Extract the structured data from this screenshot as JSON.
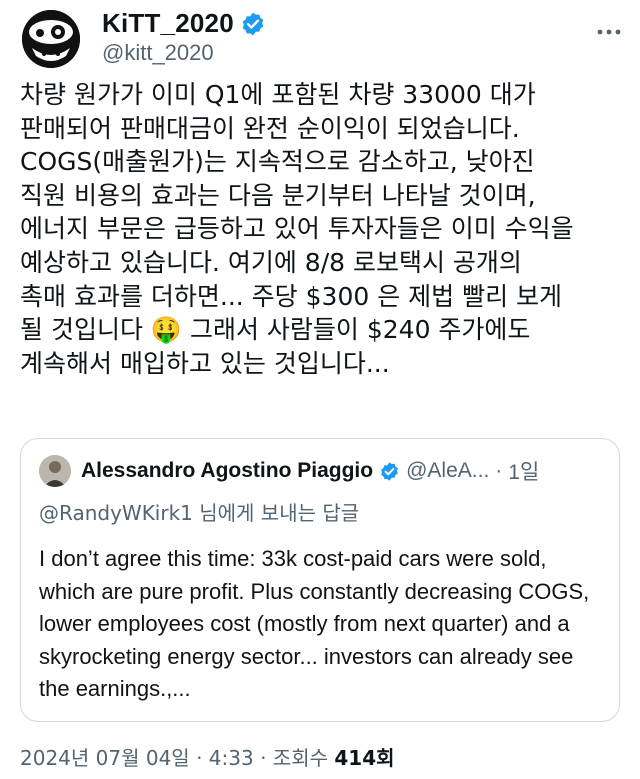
{
  "author": {
    "display_name": "KiTT_2020",
    "handle": "@kitt_2020"
  },
  "tweet": {
    "text": "차량 원가가 이미 Q1에 포함된 차량 33000 대가\n판매되어 판매대금이 완전 순이익이 되었습니다.\nCOGS(매출원가)는 지속적으로 감소하고, 낮아진\n직원 비용의 효과는 다음 분기부터 나타날 것이며,\n에너지 부문은 급등하고 있어 투자자들은 이미 수익을\n예상하고 있습니다. 여기에 8/8 로보택시 공개의\n촉매 효과를 더하면... 주당 $300 은 제법 빨리 보게\n될 것입니다 🤑 그래서 사람들이 $240 주가에도\n계속해서 매입하고 있는 것입니다..."
  },
  "quoted": {
    "display_name": "Alessandro Agostino Piaggio",
    "handle": "@AleA...",
    "separator": "·",
    "time": "1일",
    "reply_to": "@RandyWKirk1 님에게 보내는 답글",
    "text": "I don’t agree this time: 33k cost-paid cars were sold, which are pure profit. Plus constantly decreasing COGS, lower employees cost (mostly from next quarter) and a skyrocketing energy sector... investors can already see the earnings.,..."
  },
  "meta": {
    "date": "2024년 07월 04일",
    "time": "4:33",
    "views_label": "조회수",
    "views_count": "414회",
    "dot": "·"
  },
  "colors": {
    "verified_blue": "#1d9bf0",
    "secondary_text": "#536471",
    "border": "#cfd9de"
  },
  "icons": [
    "verified-badge-icon",
    "more-icon"
  ]
}
